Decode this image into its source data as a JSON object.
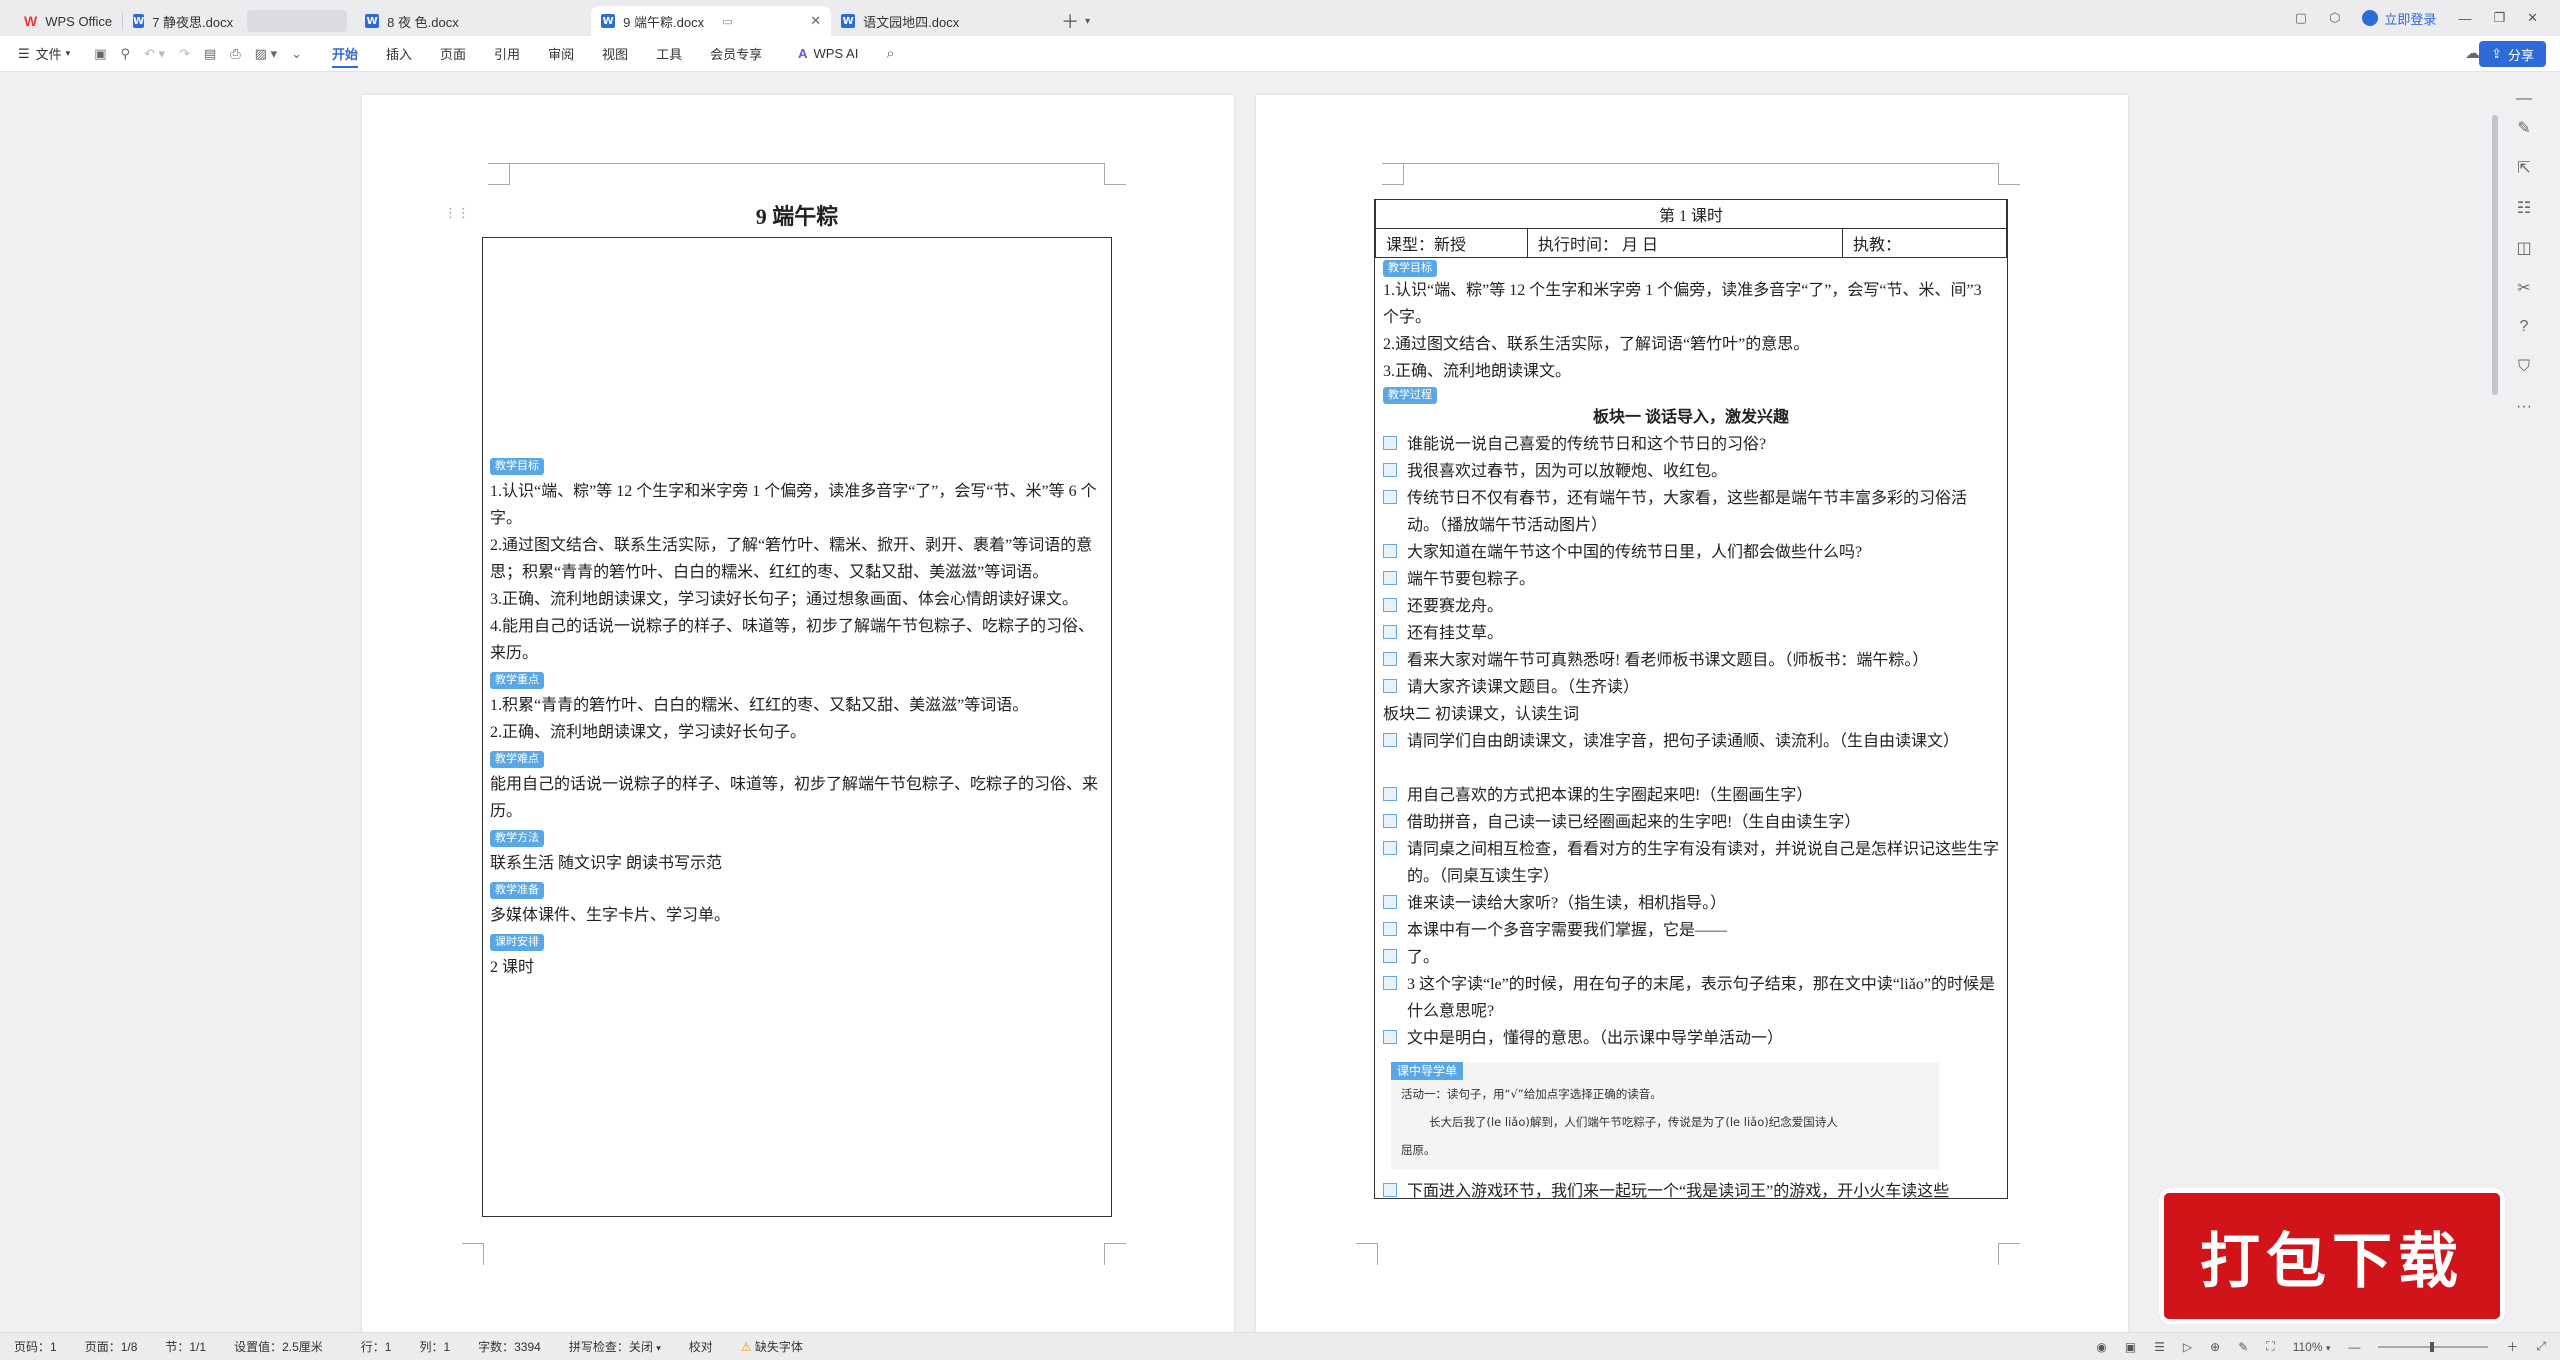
{
  "tabs": [
    {
      "label": "WPS Office",
      "icon": "wps-logo"
    },
    {
      "label": "7 静夜思.docx",
      "icon": "word-icon"
    },
    {
      "label": "",
      "icon": ""
    },
    {
      "label": "8 夜 色.docx",
      "icon": "word-icon"
    },
    {
      "label": "9 端午粽.docx",
      "icon": "word-icon",
      "active": true
    },
    {
      "label": "语文园地四.docx",
      "icon": "word-icon"
    }
  ],
  "titlebar": {
    "login": "立即登录"
  },
  "ribbon": {
    "file": "文件",
    "items": [
      "开始",
      "插入",
      "页面",
      "引用",
      "审阅",
      "视图",
      "工具",
      "会员专享",
      "WPS AI"
    ],
    "share": "分享"
  },
  "page1": {
    "title": "9 端午粽",
    "tag1": "教学目标",
    "goals": [
      "1.认识“端、粽”等 12 个生字和米字旁 1 个偏旁，读准多音字“了”，会写“节、米”等 6 个字。",
      "2.通过图文结合、联系生活实际，了解“箬竹叶、糯米、掀开、剥开、裹着”等词语的意思；积累“青青的箬竹叶、白白的糯米、红红的枣、又黏又甜、美滋滋”等词语。",
      "3.正确、流利地朗读课文，学习读好长句子；通过想象画面、体会心情朗读好课文。",
      "4.能用自己的话说一说粽子的样子、味道等，初步了解端午节包粽子、吃粽子的习俗、来历。"
    ],
    "tag2": "教学重点",
    "key": [
      "1.积累“青青的箬竹叶、白白的糯米、红红的枣、又黏又甜、美滋滋”等词语。",
      "2.正确、流利地朗读课文，学习读好长句子。"
    ],
    "tag3": "教学难点",
    "difficult": "能用自己的话说一说粽子的样子、味道等，初步了解端午节包粽子、吃粽子的习俗、来历。",
    "tag4": "教学方法",
    "methods": "联系生活 随文识字 朗读书写示范",
    "tag5": "教学准备",
    "prep": "多媒体课件、生字卡片、学习单。",
    "tag6": "课时安排",
    "hours": "2 课时"
  },
  "page2": {
    "lesson": "第 1 课时",
    "type": "课型：新授",
    "time": "执行时间：      月      日",
    "teacher": "执教：",
    "tag1": "教学目标",
    "goals": [
      "1.认识“端、粽”等 12 个生字和米字旁 1 个偏旁，读准多音字“了”，会写“节、米、间”3 个字。",
      "2.通过图文结合、联系生活实际，了解词语“箬竹叶”的意思。",
      "3.正确、流利地朗读课文。"
    ],
    "tag2": "教学过程",
    "block1": "板块一  谈话导入，激发兴趣",
    "rows1": [
      "谁能说一说自己喜爱的传统节日和这个节日的习俗?",
      "我很喜欢过春节，因为可以放鞭炮、收红包。",
      "传统节日不仅有春节，还有端午节，大家看，这些都是端午节丰富多彩的习俗活动。（播放端午节活动图片）",
      "大家知道在端午节这个中国的传统节日里，人们都会做些什么吗?",
      "端午节要包粽子。",
      "还要赛龙舟。",
      "还有挂艾草。",
      "看来大家对端午节可真熟悉呀! 看老师板书课文题目。（师板书：端午粽。）",
      "请大家齐读课文题目。（生齐读）"
    ],
    "block2": "板块二  初读课文，认读生词",
    "rows2": [
      "请同学们自由朗读课文，读准字音，把句子读通顺、读流利。（生自由读课文）",
      "用自己喜欢的方式把本课的生字圈起来吧!（生圈画生字）",
      "借助拼音，自己读一读已经圈画起来的生字吧!（生自由读生字）",
      "请同桌之间相互检查，看看对方的生字有没有读对，并说说自己是怎样识记这些生字的。（同桌互读生字）",
      "谁来读一读给大家听?（指生读，相机指导。）",
      "本课中有一个多音字需要我们掌握，它是——",
      "了。",
      "3 这个字读“le”的时候，用在句子的末尾，表示句子结束，那在文中读“liǎo”的时候是什么意思呢?",
      "文中是明白，懂得的意思。（出示课中导学单活动一）"
    ],
    "worksheet": {
      "head": "课中导学单",
      "line1": "活动一：读句子，用“√”给加点字选择正确的读音。",
      "line2": "长大后我了(le  liǎo)解到，人们端午节吃粽子，传说是为了(le  liǎo)纪念爱国诗人",
      "line3": "屈原。"
    },
    "last": "下面进入游戏环节，我们来一起玩一个“我是读词王”的游戏，开小火车读这些"
  },
  "status": {
    "page": "页码：1",
    "pages": "页面：1/8",
    "section": "节：1/1",
    "setting": "设置值：2.5厘米",
    "row": "行：1",
    "col": "列：1",
    "words": "字数：3394",
    "spell": "拼写检查：关闭",
    "proof": "校对",
    "font": "缺失字体",
    "zoom": "110%"
  },
  "promo": "打包下载"
}
